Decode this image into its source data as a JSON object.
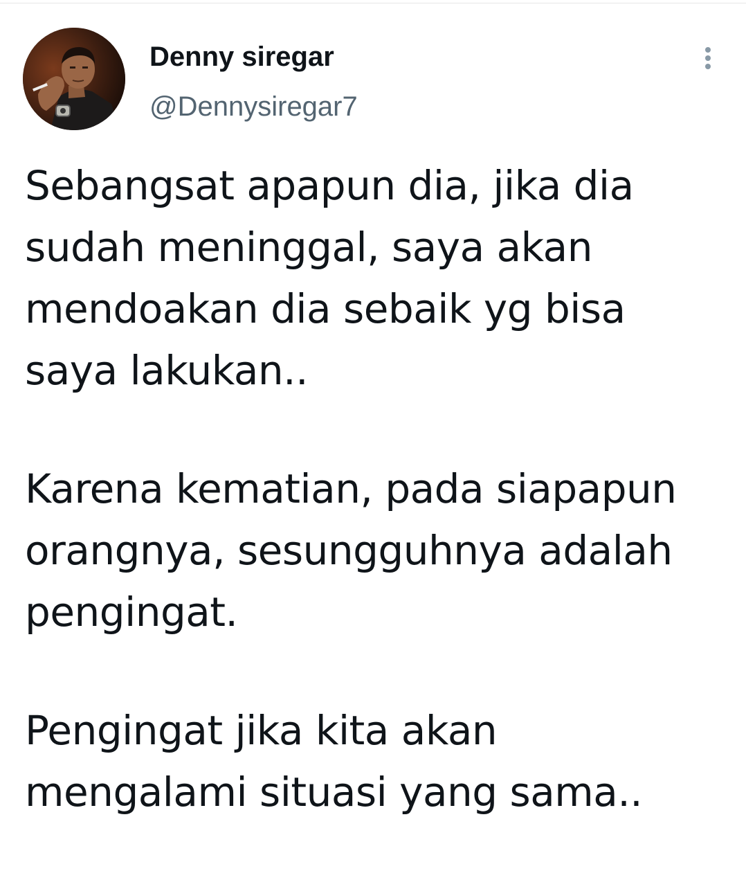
{
  "tweet": {
    "author": {
      "display_name": "Denny siregar",
      "handle": "@Dennysiregar7",
      "avatar_icon": "profile-photo"
    },
    "more_icon": "vertical-ellipsis-icon",
    "paragraphs": [
      [
        "Sebangsat apapun dia, jika dia",
        "sudah meninggal, saya akan",
        "mendoakan dia sebaik yg bisa",
        "saya lakukan.."
      ],
      [
        "Karena kematian, pada siapapun",
        "orangnya, sesungguhnya adalah",
        "pengingat."
      ],
      [
        "Pengingat jika kita akan",
        "mengalami situasi yang sama.."
      ]
    ]
  },
  "colors": {
    "text": "#0f1419",
    "secondary": "#536471",
    "icon": "#8899a6",
    "background": "#ffffff"
  }
}
